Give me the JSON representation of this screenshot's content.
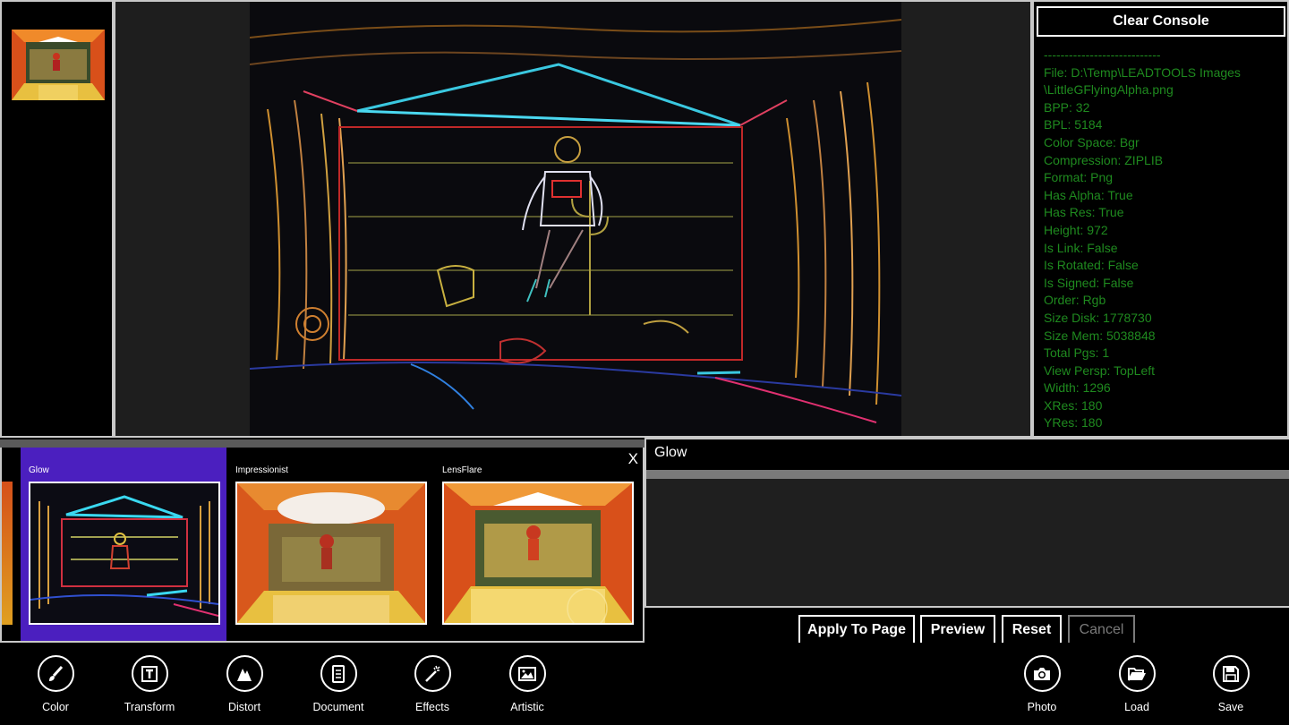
{
  "console": {
    "clear_label": "Clear Console",
    "lines": [
      "----------------------------",
      "File: D:\\Temp\\LEADTOOLS Images",
      "\\LittleGFlyingAlpha.png",
      "BPP: 32",
      "BPL: 5184",
      "Color Space: Bgr",
      "Compression: ZIPLIB",
      "Format: Png",
      "Has Alpha: True",
      "Has Res: True",
      "Height: 972",
      "Is Link: False",
      "Is Rotated: False",
      "Is Signed: False",
      "Order: Rgb",
      "Size Disk: 1778730",
      "Size Mem: 5038848",
      "Total Pgs: 1",
      "View Persp: TopLeft",
      "Width: 1296",
      "XRes: 180",
      "YRes: 180"
    ],
    "text_color": "#1f8a1f"
  },
  "effects": {
    "close_label": "X",
    "items": [
      {
        "label": "Glow",
        "selected": true
      },
      {
        "label": "Impressionist",
        "selected": false
      },
      {
        "label": "LensFlare",
        "selected": false
      }
    ],
    "selected_color": "#4b1fbf"
  },
  "properties": {
    "title": "Glow",
    "buttons": {
      "apply": "Apply To Page",
      "preview": "Preview",
      "reset": "Reset",
      "cancel": "Cancel"
    }
  },
  "appbar": {
    "left": [
      {
        "label": "Color",
        "icon": "brush-icon"
      },
      {
        "label": "Transform",
        "icon": "transform-icon"
      },
      {
        "label": "Distort",
        "icon": "distort-icon"
      },
      {
        "label": "Document",
        "icon": "document-icon"
      },
      {
        "label": "Effects",
        "icon": "magic-wand-icon"
      },
      {
        "label": "Artistic",
        "icon": "artistic-icon"
      }
    ],
    "right": [
      {
        "label": "Photo",
        "icon": "camera-icon"
      },
      {
        "label": "Load",
        "icon": "folder-open-icon"
      },
      {
        "label": "Save",
        "icon": "save-icon"
      }
    ]
  }
}
